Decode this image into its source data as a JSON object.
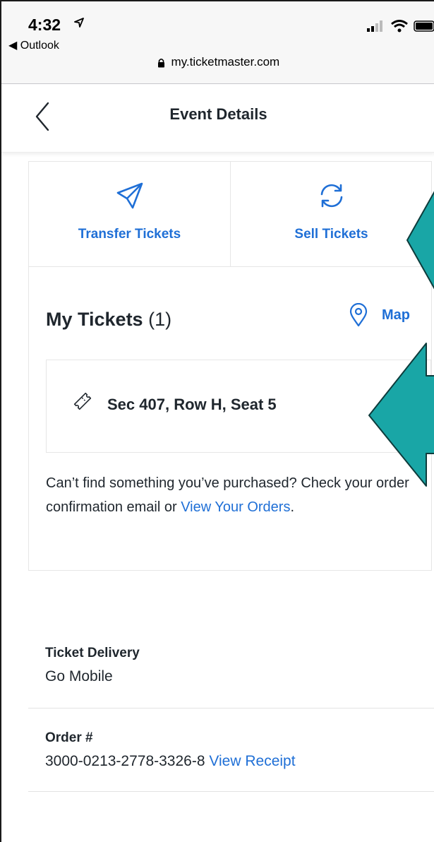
{
  "status_bar": {
    "time": "4:32",
    "back_app": "◀ Outlook",
    "url": "my.ticketmaster.com"
  },
  "header": {
    "title": "Event Details"
  },
  "actions": {
    "transfer_label": "Transfer Tickets",
    "sell_label": "Sell Tickets"
  },
  "tickets": {
    "title": "My Tickets",
    "count": "(1)",
    "map_label": "Map",
    "items": [
      {
        "label": "Sec 407, Row H, Seat 5"
      }
    ]
  },
  "help": {
    "text_before": "Can’t find something you’ve purchased? Check your order confirmation email or ",
    "link": "View Your Orders",
    "text_after": "."
  },
  "delivery": {
    "label": "Ticket Delivery",
    "value": "Go Mobile"
  },
  "order": {
    "label": "Order #",
    "number": "3000-0213-2778-3326-8",
    "receipt_link": "View Receipt"
  },
  "colors": {
    "accent": "#1f6fd6",
    "annotation_arrow": "#19a6a6"
  }
}
